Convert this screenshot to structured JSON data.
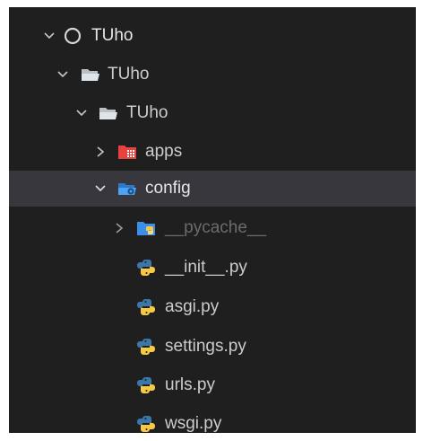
{
  "explorer": {
    "tree": [
      {
        "label": "TUho",
        "icon": "circle-outline-icon",
        "expanded": true
      },
      {
        "label": "TUho",
        "icon": "folder-open-icon",
        "expanded": true
      },
      {
        "label": "TUho",
        "icon": "folder-open-icon",
        "expanded": true
      },
      {
        "label": "apps",
        "icon": "apps-folder-icon",
        "expanded": false
      },
      {
        "label": "config",
        "icon": "config-folder-icon",
        "expanded": true,
        "selected": true
      },
      {
        "label": "__pycache__",
        "icon": "python-folder-icon",
        "expanded": false,
        "dimmed": true
      },
      {
        "label": "__init__.py",
        "icon": "python-file-icon"
      },
      {
        "label": "asgi.py",
        "icon": "python-file-icon"
      },
      {
        "label": "settings.py",
        "icon": "python-file-icon"
      },
      {
        "label": "urls.py",
        "icon": "python-file-icon"
      },
      {
        "label": "wsgi.py",
        "icon": "python-file-icon"
      }
    ]
  },
  "colors": {
    "background": "#1f1f1f",
    "selected_row": "#37373d",
    "text": "#cccccc",
    "apps_folder": "#e8423f",
    "config_folder": "#3b8eea",
    "python_blue": "#3b77a8",
    "python_yellow": "#f7c843"
  }
}
